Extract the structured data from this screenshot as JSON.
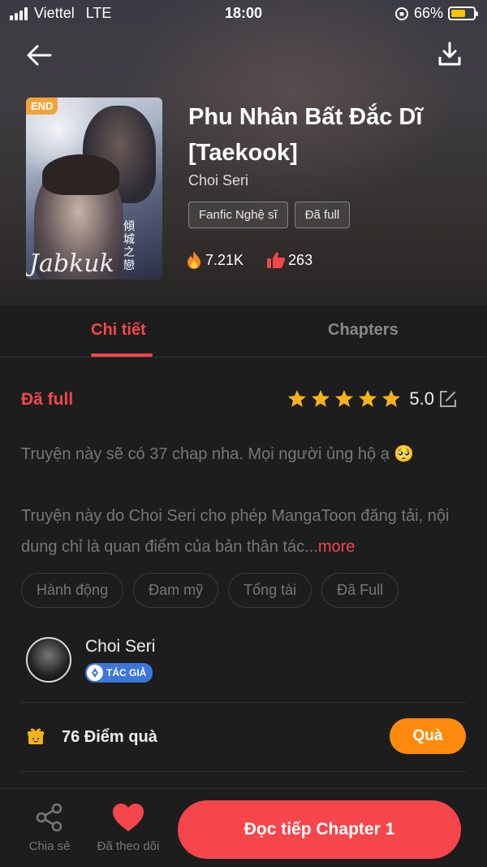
{
  "status_bar": {
    "carrier": "Viettel",
    "network": "LTE",
    "time": "18:00",
    "battery": "66%",
    "battery_level": 0.66
  },
  "book": {
    "badge": "END",
    "title": "Phu Nhân Bất Đắc Dĩ [Taekook]",
    "author": "Choi Seri",
    "tags": [
      "Fanfic Nghệ sĩ",
      "Đã full"
    ],
    "views": "7.21K",
    "likes": "263",
    "cover_script": "Jabkuk",
    "cover_cjk": "傾城之戀"
  },
  "tabs": [
    {
      "label": "Chi tiết",
      "active": true
    },
    {
      "label": "Chapters",
      "active": false
    }
  ],
  "detail": {
    "status": "Đã full",
    "rating_stars": 5,
    "rating_value": "5.0",
    "description": "Truyện này sẽ có 37 chap nha. Mọi người ủng hộ ạ 🥺",
    "disclaimer": "Truyện này do Choi Seri cho phép MangaToon đăng tải, nội dung chỉ là quan điểm của bản thân tác...",
    "more_label": "more",
    "genres": [
      "Hành động",
      "Đam mỹ",
      "Tổng tài",
      "Đã Full"
    ]
  },
  "author_info": {
    "name": "Choi Seri",
    "badge": "TÁC GIẢ"
  },
  "gift": {
    "points_text": "76 Điểm quà",
    "button_label": "Quà"
  },
  "bottom_bar": {
    "share_label": "Chia sẻ",
    "follow_label": "Đã theo dõi",
    "read_label": "Đọc tiếp Chapter 1"
  },
  "colors": {
    "accent": "#f5464b",
    "gift_button": "#ff8a0d",
    "star": "#f5b21b",
    "badge_end": "#f2a43c",
    "author_badge": "#3c76d9",
    "background": "#1d1d1d"
  }
}
